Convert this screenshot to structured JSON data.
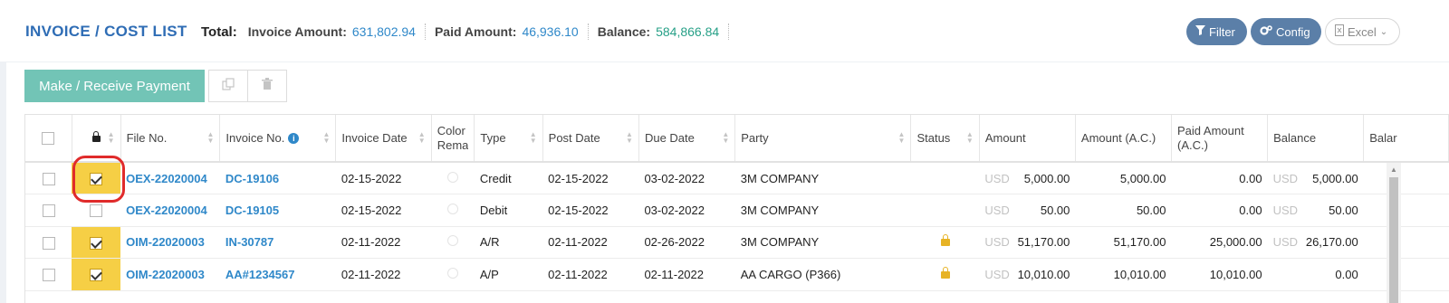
{
  "header": {
    "title": "INVOICE / COST LIST",
    "total_label": "Total:",
    "totals": [
      {
        "label": "Invoice Amount:",
        "value": "631,802.94"
      },
      {
        "label": "Paid Amount:",
        "value": "46,936.10"
      },
      {
        "label": "Balance:",
        "value": "584,866.84"
      }
    ],
    "buttons": {
      "filter": "Filter",
      "config": "Config",
      "excel": "Excel"
    }
  },
  "toolbar": {
    "pay_label": "Make / Receive Payment",
    "copy_icon": "copy-icon",
    "delete_icon": "trash-icon"
  },
  "table": {
    "columns": [
      "File No.",
      "Invoice No.",
      "Invoice Date",
      "Color Rema",
      "Type",
      "Post Date",
      "Due Date",
      "Party",
      "Status",
      "Amount",
      "Amount (A.C.)",
      "Paid Amount (A.C.)",
      "Balance",
      "Balar"
    ],
    "rows": [
      {
        "locked": true,
        "file_no": "OEX-22020004",
        "invoice_no": "DC-19106",
        "invoice_date": "02-15-2022",
        "type": "Credit",
        "post_date": "02-15-2022",
        "due_date": "03-02-2022",
        "party": "3M COMPANY",
        "status_lock": false,
        "currency": "USD",
        "amount": "5,000.00",
        "amount_ac": "5,000.00",
        "paid_ac": "0.00",
        "bal_currency": "USD",
        "balance": "5,000.00"
      },
      {
        "locked": false,
        "file_no": "OEX-22020004",
        "invoice_no": "DC-19105",
        "invoice_date": "02-15-2022",
        "type": "Debit",
        "post_date": "02-15-2022",
        "due_date": "03-02-2022",
        "party": "3M COMPANY",
        "status_lock": false,
        "currency": "USD",
        "amount": "50.00",
        "amount_ac": "50.00",
        "paid_ac": "0.00",
        "bal_currency": "USD",
        "balance": "50.00"
      },
      {
        "locked": true,
        "file_no": "OIM-22020003",
        "invoice_no": "IN-30787",
        "invoice_date": "02-11-2022",
        "type": "A/R",
        "post_date": "02-11-2022",
        "due_date": "02-26-2022",
        "party": "3M COMPANY",
        "status_lock": true,
        "currency": "USD",
        "amount": "51,170.00",
        "amount_ac": "51,170.00",
        "paid_ac": "25,000.00",
        "bal_currency": "USD",
        "balance": "26,170.00"
      },
      {
        "locked": true,
        "file_no": "OIM-22020003",
        "invoice_no": "AA#1234567",
        "invoice_date": "02-11-2022",
        "type": "A/P",
        "post_date": "02-11-2022",
        "due_date": "02-11-2022",
        "party": "AA CARGO (P366)",
        "status_lock": true,
        "currency": "USD",
        "amount": "10,010.00",
        "amount_ac": "10,010.00",
        "paid_ac": "10,010.00",
        "bal_currency": "",
        "balance": "0.00"
      }
    ]
  },
  "colors": {
    "title": "#2f6db5",
    "pay_button": "#72c4b6",
    "pill_button": "#5b7fa8",
    "lock_highlight": "#f6cf45",
    "link": "#2f88c9",
    "annotation_ring": "#e02b2b"
  }
}
